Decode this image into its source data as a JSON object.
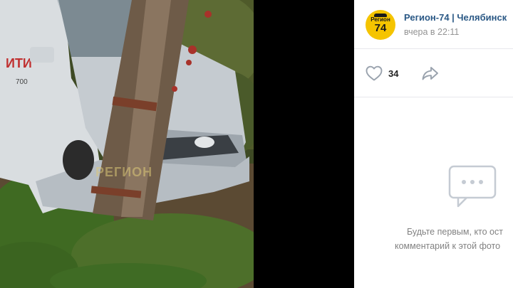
{
  "post": {
    "group_name": "Регион-74 | Челябинск",
    "time": "вчера в 22:11",
    "avatar": {
      "line1": "Регион",
      "line2": "74",
      "brand_color": "#f5c400"
    }
  },
  "photo": {
    "description_icon": "photo-viewer",
    "watermark_text": "РЕГИОН"
  },
  "actions": {
    "like_icon": "heart-icon",
    "like_count": "34",
    "share_icon": "share-arrow-icon"
  },
  "comments": {
    "empty_icon": "comment-bubble-icon",
    "empty_line1": "Будьте первым, кто ост",
    "empty_line2": "комментарий к этой фото"
  },
  "colors": {
    "link": "#2a5885",
    "muted": "#939393",
    "icon": "#99a2ad",
    "border": "#e7e8ec"
  }
}
